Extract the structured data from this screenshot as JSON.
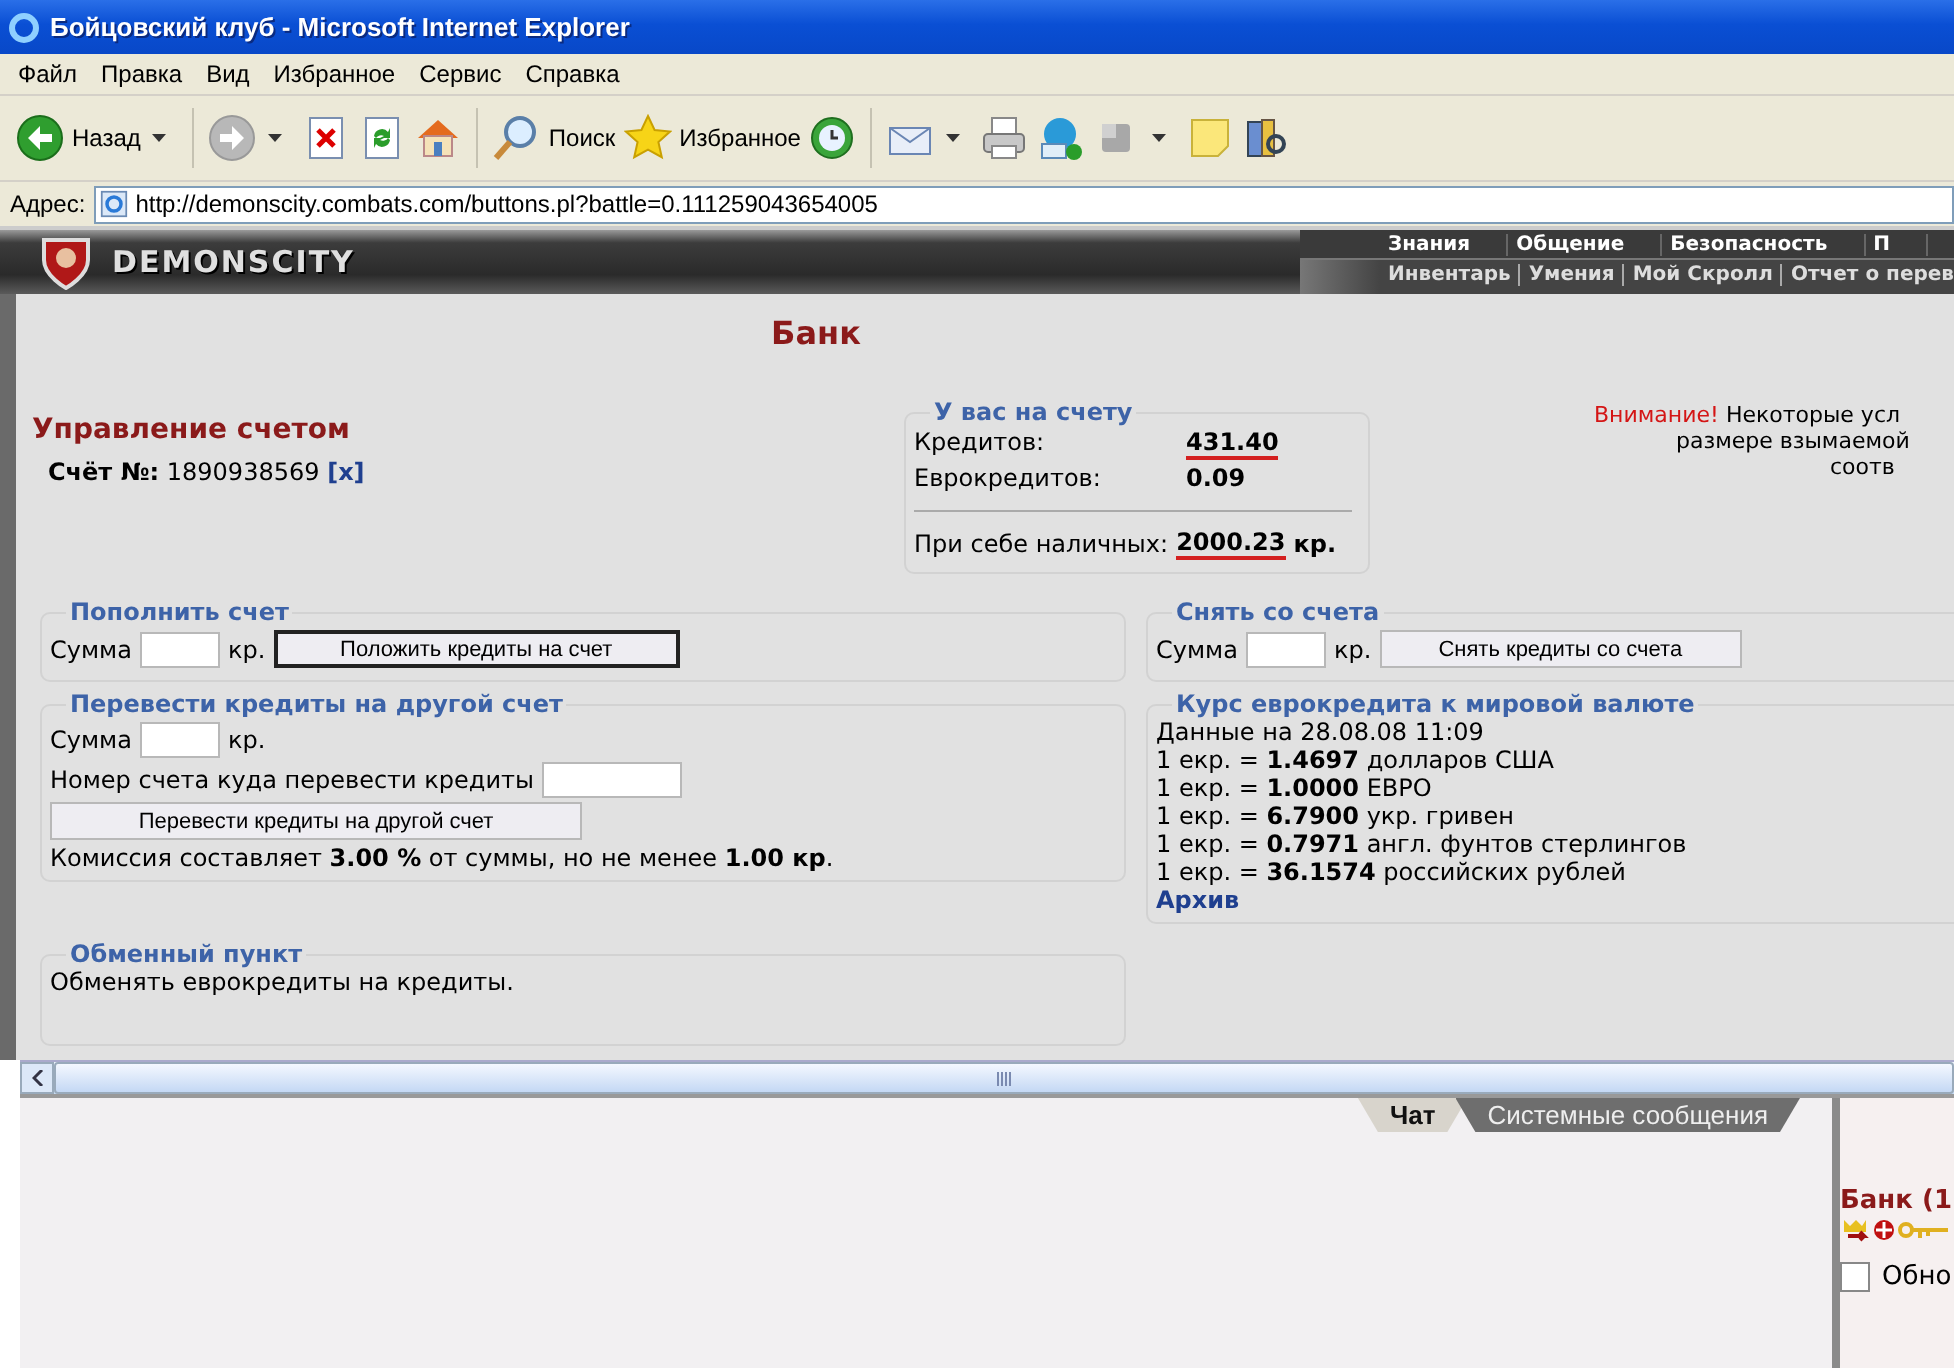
{
  "window": {
    "title": "Бойцовский клуб - Microsoft Internet Explorer"
  },
  "menu": [
    "Файл",
    "Правка",
    "Вид",
    "Избранное",
    "Сервис",
    "Справка"
  ],
  "toolbar": {
    "back_label": "Назад",
    "search_label": "Поиск",
    "favorites_label": "Избранное"
  },
  "address": {
    "label": "Адрес:",
    "url": "http://demonscity.combats.com/buttons.pl?battle=0.111259043654005"
  },
  "site_header": {
    "logo": "DEMONSCITY",
    "nav_top": [
      "Знания",
      "Общение",
      "Безопасность",
      "П"
    ],
    "nav_bottom": [
      "Инвентарь",
      "Умения",
      "Мой Скролл",
      "Отчет о перев"
    ]
  },
  "page_title": "Банк",
  "account": {
    "heading": "Управление счетом",
    "number_label": "Счёт №:",
    "number": "1890938569",
    "close_link": "[x]"
  },
  "balance": {
    "heading": "У вас на счету",
    "rows": [
      {
        "label": "Кредитов:",
        "value": "431.40",
        "highlighted": true
      },
      {
        "label": "Еврокредитов:",
        "value": "0.09",
        "highlighted": false
      }
    ],
    "cash": {
      "label": "При себе наличных:",
      "value": "2000.23",
      "unit": "кр.",
      "highlighted": true
    }
  },
  "warning": {
    "label": "Внимание!",
    "lines": [
      "Некоторые усл",
      "размере взымаемой",
      "соотв"
    ]
  },
  "deposit": {
    "heading": "Пополнить счет",
    "amount_label": "Сумма",
    "unit": "кр.",
    "button": {
      "label": "Положить кредиты на счет",
      "focused": true
    }
  },
  "withdraw": {
    "heading": "Снять со счета",
    "amount_label": "Сумма",
    "unit": "кр.",
    "button": {
      "label": "Снять кредиты со счета",
      "focused": false
    }
  },
  "transfer": {
    "heading": "Перевести кредиты на другой счет",
    "amount_label": "Сумма",
    "unit": "кр.",
    "account_label": "Номер счета куда перевести кредиты",
    "button": {
      "label": "Перевести кредиты на другой счет",
      "focused": false
    },
    "commission": "Комиссия составляет **3.00 %** от суммы, но не менее **1.00 кр**."
  },
  "rates": {
    "heading": "Курс еврокредита к мировой валюте",
    "date": "Данные на 28.08.08 11:09",
    "lines": [
      "1 екр. = **1.4697** долларов США",
      "1 екр. = **1.0000** ЕВРО",
      "1 екр. = **6.7900** укр. гривен",
      "1 екр. = **0.7971** англ. фунтов стерлингов",
      "1 екр. = **36.1574** российских рублей"
    ],
    "archive_link": "Архив"
  },
  "exchange": {
    "heading": "Обменный пункт",
    "text": "Обменять еврокредиты на кредиты."
  },
  "chat": {
    "tabs": [
      {
        "label": "Чат",
        "selected": true
      },
      {
        "label": "Системные сообщения",
        "selected": false
      }
    ]
  },
  "side_panel": {
    "location": "Банк (1",
    "refresh_label": "Обно",
    "refresh_checked": false
  }
}
